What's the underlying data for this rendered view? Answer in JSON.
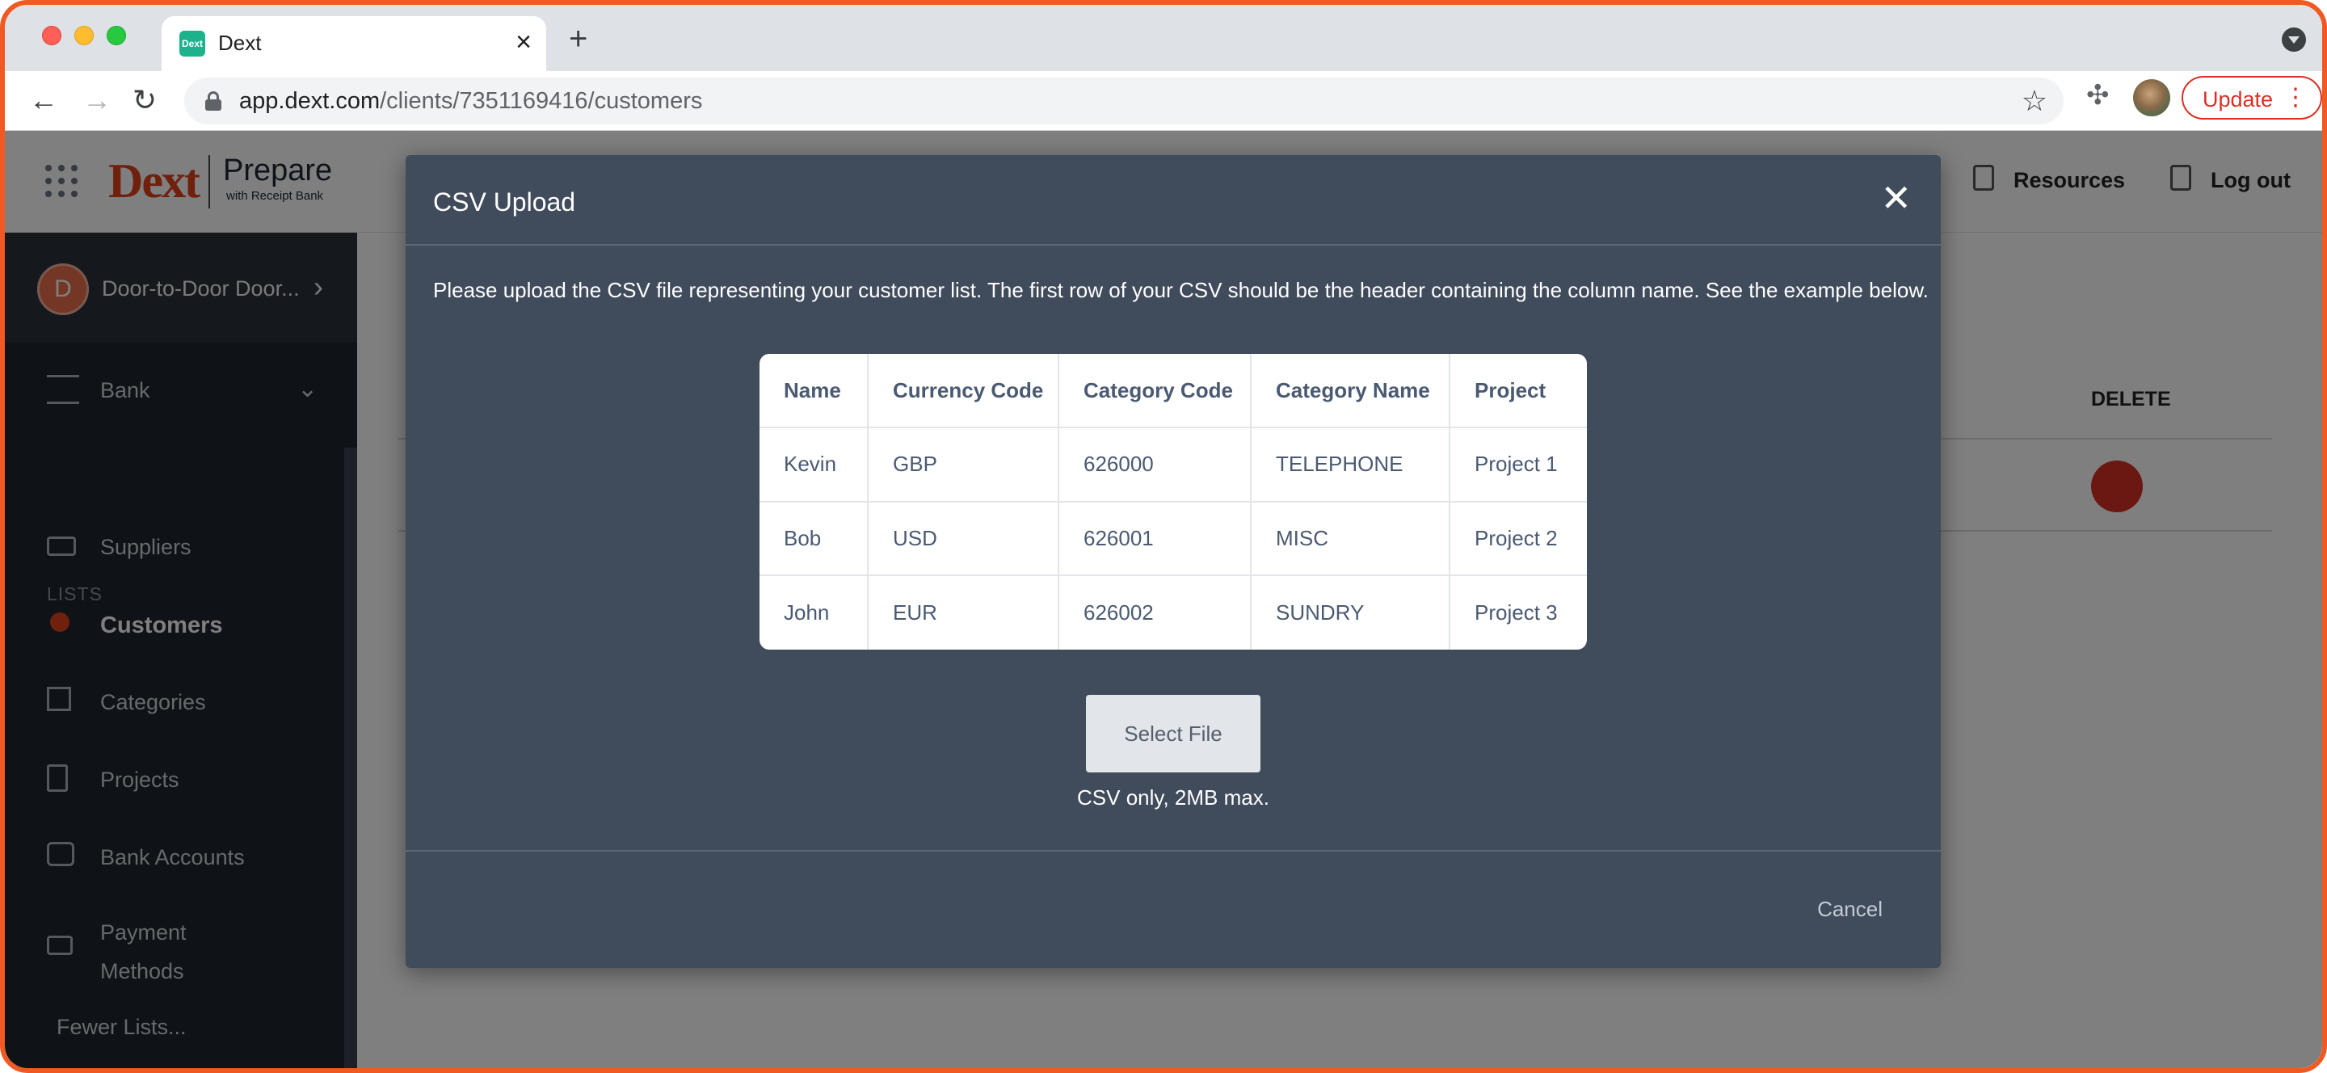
{
  "browser": {
    "tab_title": "Dext",
    "tab_favicon_text": "Dext",
    "url_host": "app.dext.com",
    "url_path": "/clients/7351169416/customers",
    "update_label": "Update"
  },
  "app_header": {
    "logo_text": "Dext",
    "product_name": "Prepare",
    "product_sub": "with Receipt Bank",
    "links": [
      {
        "label": "Resources"
      },
      {
        "label": "Log out"
      }
    ]
  },
  "sidebar": {
    "client_initial": "D",
    "client_name": "Door-to-Door Door...",
    "bank_label": "Bank",
    "section_label": "LISTS",
    "items": [
      {
        "label": "Suppliers",
        "icon": "truck-icon"
      },
      {
        "label": "Customers",
        "icon": "customer-icon",
        "active": true
      },
      {
        "label": "Categories",
        "icon": "categories-icon"
      },
      {
        "label": "Projects",
        "icon": "project-icon"
      },
      {
        "label": "Bank Accounts",
        "icon": "bank-accounts-icon"
      },
      {
        "label": "Payment Methods",
        "icon": "payment-methods-icon"
      }
    ],
    "fewer_lists": "Fewer Lists..."
  },
  "background_table": {
    "delete_header": "DELETE"
  },
  "modal": {
    "title": "CSV Upload",
    "description": "Please upload the CSV file representing your customer list. The first row of your CSV should be the header containing the column name. See the example below.",
    "table": {
      "headers": [
        "Name",
        "Currency Code",
        "Category Code",
        "Category Name",
        "Project"
      ],
      "rows": [
        [
          "Kevin",
          "GBP",
          "626000",
          "TELEPHONE",
          "Project 1"
        ],
        [
          "Bob",
          "USD",
          "626001",
          "MISC",
          "Project 2"
        ],
        [
          "John",
          "EUR",
          "626002",
          "SUNDRY",
          "Project 3"
        ]
      ]
    },
    "select_file_label": "Select File",
    "file_hint": "CSV only, 2MB max.",
    "cancel_label": "Cancel"
  },
  "colors": {
    "accent": "#e0421c",
    "modal_bg": "#404b5c",
    "sidebar_bg": "#1e2630",
    "frame": "#f05a22"
  }
}
